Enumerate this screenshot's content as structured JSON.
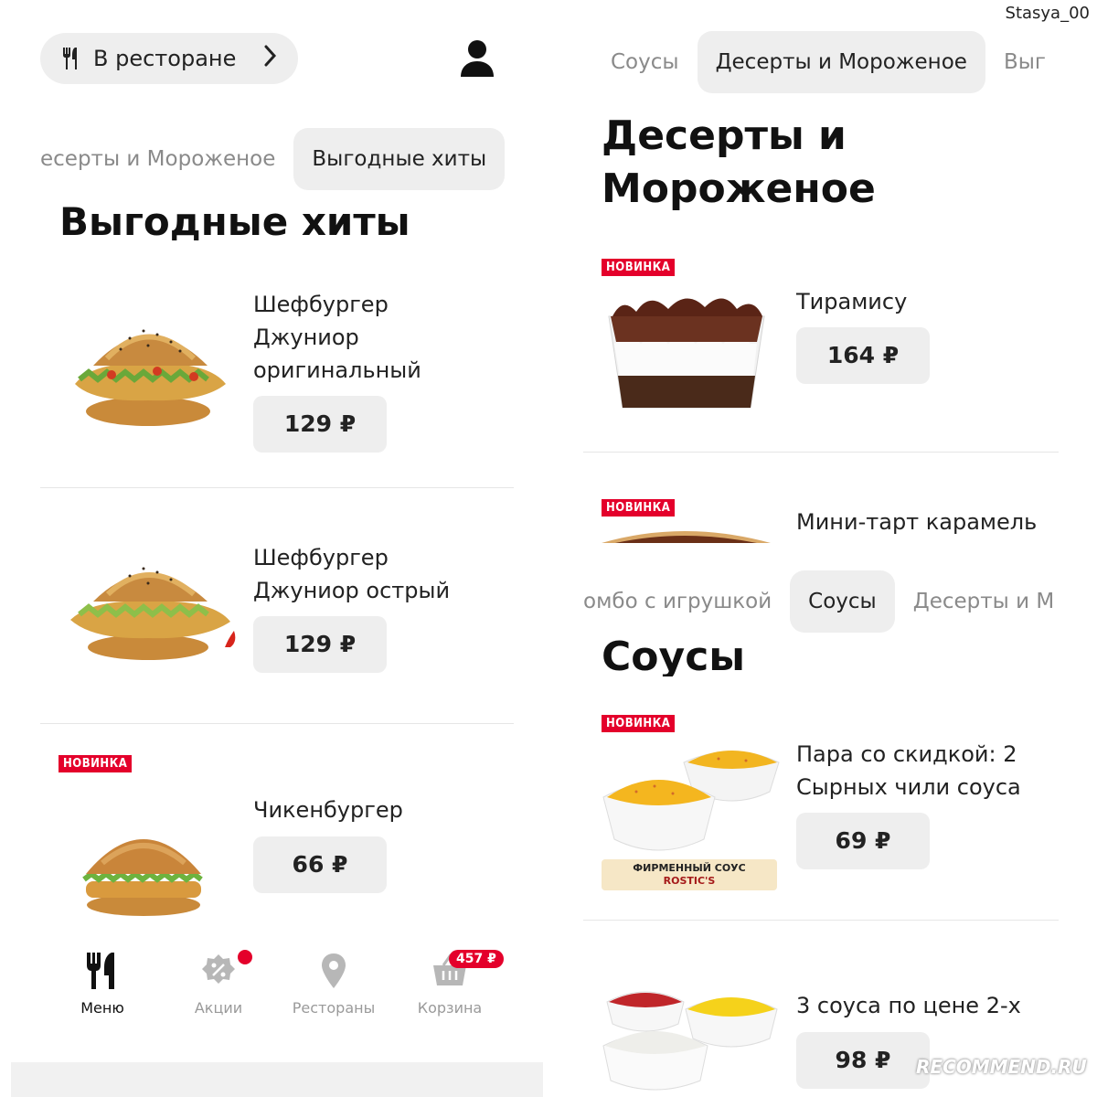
{
  "watermark": "Stasya_00",
  "left": {
    "location_pill": {
      "label": "В ресторане"
    },
    "tabs": [
      {
        "label": "есерты и Мороженое",
        "active": false
      },
      {
        "label": "Выгодные хиты",
        "active": true
      }
    ],
    "section_title": "Выгодные хиты",
    "products": [
      {
        "name": "Шефбургер Джуниор оригинальный",
        "price": "129 ₽",
        "badge": ""
      },
      {
        "name": "Шефбургер Джуниор острый",
        "price": "129 ₽",
        "badge": ""
      },
      {
        "name": "Чикенбургер",
        "price": "66 ₽",
        "badge": "НОВИНКА"
      }
    ],
    "bottom_nav": [
      {
        "label": "Меню",
        "icon": "fork-knife-icon",
        "active": true
      },
      {
        "label": "Акции",
        "icon": "discount-icon",
        "active": false
      },
      {
        "label": "Рестораны",
        "icon": "location-pin-icon",
        "active": false
      },
      {
        "label": "Корзина",
        "icon": "basket-icon",
        "active": false,
        "badge": "457 ₽"
      }
    ]
  },
  "right_top": {
    "tabs": [
      {
        "label": "Соусы",
        "active": false
      },
      {
        "label": "Десерты и Мороженое",
        "active": true
      },
      {
        "label": "Выг",
        "active": false
      }
    ],
    "section_title_line1": "Десерты и",
    "section_title_line2": "Мороженое",
    "products": [
      {
        "name": "Тирамису",
        "price": "164 ₽",
        "badge": "НОВИНКА"
      },
      {
        "name": "Мини-тарт карамель",
        "badge": "НОВИНКА"
      }
    ]
  },
  "right_bottom": {
    "tabs": [
      {
        "label": "омбо с игрушкой",
        "active": false
      },
      {
        "label": "Соусы",
        "active": true
      },
      {
        "label": "Десерты и М",
        "active": false
      }
    ],
    "section_title": "Соусы",
    "products": [
      {
        "name_line1": "Пара со скидкой: 2",
        "name_line2": "Сырных чили соуса",
        "price": "69 ₽",
        "badge": "НОВИНКА",
        "promo_line1": "ФИРМЕННЫЙ СОУС",
        "promo_line2": "ROSTIC'S"
      },
      {
        "name": "3 соуса по цене 2-х",
        "price": "98 ₽"
      }
    ]
  },
  "site_logo": "RECOMMEND.RU",
  "colors": {
    "accent": "#e4002b",
    "pill_bg": "#eeeeee",
    "text": "#222222",
    "muted": "#8a8a8a"
  }
}
